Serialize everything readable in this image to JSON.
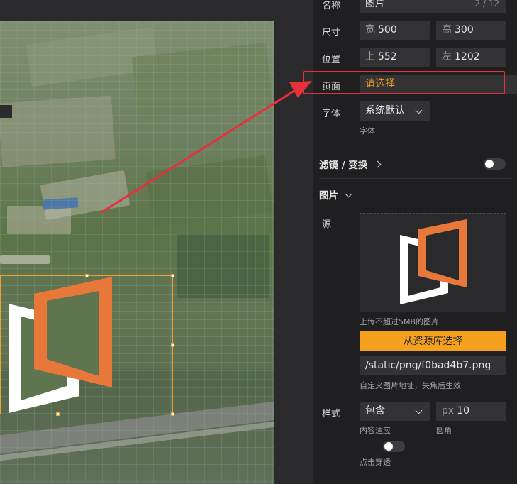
{
  "panel": {
    "name": {
      "label": "名称",
      "value": "图片",
      "counter": "2 / 12"
    },
    "size": {
      "label": "尺寸",
      "width_prefix": "宽",
      "width": "500",
      "height_prefix": "高",
      "height": "300"
    },
    "position": {
      "label": "位置",
      "top_prefix": "上",
      "top": "552",
      "left_prefix": "左",
      "left": "1202"
    },
    "page": {
      "label": "页面",
      "placeholder": "请选择"
    },
    "font": {
      "label": "字体",
      "value": "系统默认",
      "hint": "字体"
    },
    "filter_section": {
      "title": "滤镜 / 变换",
      "toggle_on": false
    },
    "image_section": {
      "title": "图片",
      "source_label": "源",
      "upload_hint": "上传不超过5MB的图片",
      "library_button": "从资源库选择",
      "url_value": "/static/png/f0bad4b7.png",
      "url_hint": "自定义图片地址，失焦后生效",
      "style_label": "样式",
      "fit_value": "包含",
      "fit_hint": "内容适应",
      "radius_prefix": "px",
      "radius_value": "10",
      "radius_hint": "圆角",
      "click_through_hint": "点击穿透",
      "click_through_on": false
    }
  },
  "colors": {
    "accent": "#f5a11d",
    "highlight_box": "#e6303a",
    "arrow": "#e6303a",
    "logo_orange": "#e8773a",
    "logo_white": "#ffffff",
    "page_placeholder": "#f5a11d"
  },
  "icons": [
    "chevron-down-icon",
    "chevron-right-icon",
    "red-arrow",
    "logo-image"
  ]
}
